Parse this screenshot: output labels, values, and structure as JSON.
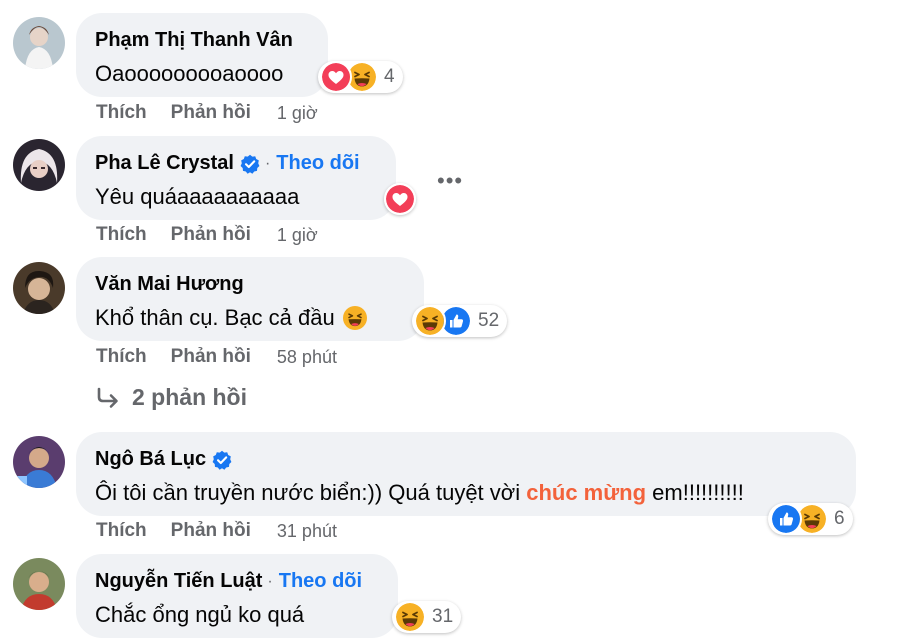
{
  "comments": [
    {
      "name": "Phạm Thị Thanh Vân",
      "text": "Oaooooooooaoooo",
      "reaction_count": "4",
      "reactions": [
        "love-icon",
        "haha-icon"
      ],
      "actions": {
        "like": "Thích",
        "reply": "Phản hồi",
        "time": "1 giờ"
      }
    },
    {
      "name": "Pha Lê Crystal",
      "follow": "Theo dõi",
      "separator": "·",
      "text": "Yêu quáaaaaaaaaaa",
      "reactions": [
        "love-icon"
      ],
      "more": "•••",
      "actions": {
        "like": "Thích",
        "reply": "Phản hồi",
        "time": "1 giờ"
      }
    },
    {
      "name": "Văn Mai Hương",
      "text": "Khổ thân cụ. Bạc cả đầu",
      "reaction_count": "52",
      "reactions": [
        "haha-icon",
        "like-icon"
      ],
      "actions": {
        "like": "Thích",
        "reply": "Phản hồi",
        "time": "58 phút"
      },
      "replies": "2 phản hồi"
    },
    {
      "name": "Ngô Bá Lục",
      "text_before": "Ôi tôi cần truyền nước biển:)) Quá tuyệt vời ",
      "text_highlight": "chúc mừng",
      "text_after": " em!!!!!!!!!!",
      "reaction_count": "6",
      "reactions": [
        "like-icon",
        "haha-icon"
      ],
      "actions": {
        "like": "Thích",
        "reply": "Phản hồi",
        "time": "31 phút"
      }
    },
    {
      "name": "Nguyễn Tiến Luật",
      "follow": "Theo dõi",
      "separator": "·",
      "text": "Chắc ổng ngủ ko quá",
      "reaction_count": "31",
      "reactions": [
        "haha-icon"
      ]
    }
  ],
  "colors": {
    "bubble": "#f0f2f5",
    "link": "#1877f2",
    "muted": "#65676b",
    "highlight": "#f3623b",
    "love": "#f33e58",
    "haha": "#f7b125"
  }
}
